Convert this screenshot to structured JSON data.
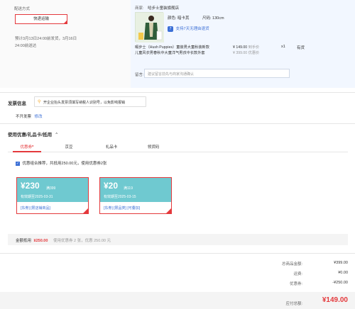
{
  "delivery": {
    "section_label": "配送方式",
    "express_button": "快递运输",
    "note_line1": "预计3月13日24:00前发货，3月16日",
    "note_line2": "24:00前送达"
  },
  "shop": {
    "label": "商家:",
    "name": "哈步士童装旗舰店"
  },
  "product": {
    "color_label": "颜色: 暗卡其",
    "size_label": "尺码: 130cm",
    "return_policy": "支持7天无理由退货",
    "name_line1": "暇步士（Hush Puppies）童装男大童秋装新款",
    "name_line2": "儿童风衣男春秋中大童洋气男孩中长款外套",
    "price": "¥ 149.00",
    "price_note": "到手价",
    "original_price": "¥ 399.00",
    "original_note": "优惠价",
    "quantity": "x1",
    "stock": "有货"
  },
  "message": {
    "label": "留言:",
    "placeholder": "建议留言前先与商家沟通确认"
  },
  "invoice": {
    "title": "发票信息",
    "notice": "开企业抬头发票须填写纳税人识别号，以免影响报销",
    "status": "不开发票",
    "edit_link": "修改"
  },
  "coupons": {
    "title": "使用优惠/礼品卡/抵用",
    "tabs": [
      "优惠券",
      "京豆",
      "礼品卡",
      "领货码"
    ],
    "combo_checkbox_label": "优惠组合推荐，共抵用250.00元，使用优惠券2张",
    "items": [
      {
        "amount": "¥230",
        "condition": "满399",
        "validity": "有效期至2025-03-31",
        "tags": "[东券] [限店铺商品]"
      },
      {
        "amount": "¥20",
        "condition": "满119",
        "validity": "有效期至2025-03-15",
        "tags": "[东券] [限品类] [可叠加]"
      }
    ],
    "summary_label": "金额抵用",
    "summary_amount": "¥250.00",
    "summary_note": "使用优惠券 2 张，优惠 250.00 元"
  },
  "totals": {
    "goods_label": "总商品金额:",
    "goods_value": "¥399.00",
    "shipping_label": "运费:",
    "shipping_value": "¥0.00",
    "coupon_label": "优惠券:",
    "coupon_value": "-¥250.00",
    "payable_label": "应付总额:",
    "payable_value": "¥149.00"
  },
  "colors": {
    "accent_red": "#e4393c",
    "coupon_teal": "#6fc9d0",
    "link_blue": "#3b6fd6"
  }
}
